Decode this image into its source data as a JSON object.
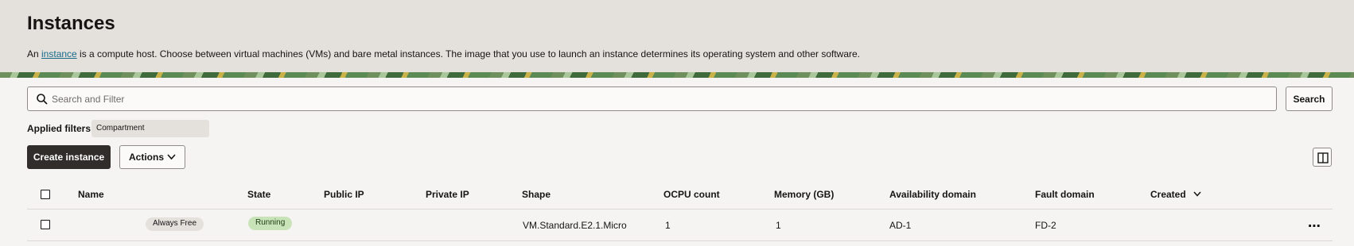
{
  "page": {
    "title": "Instances",
    "intro_prefix": "An ",
    "intro_link": "instance",
    "intro_suffix": " is a compute host. Choose between virtual machines (VMs) and bare metal instances. The image that you use to launch an instance determines its operating system and other software."
  },
  "search": {
    "placeholder": "Search and Filter",
    "button_label": "Search",
    "icon": "search-icon"
  },
  "filters": {
    "label": "Applied filters",
    "chips": [
      "Compartment"
    ]
  },
  "toolbar": {
    "create_label": "Create instance",
    "actions_label": "Actions",
    "columns_icon": "columns-icon"
  },
  "table": {
    "columns": {
      "name": "Name",
      "state": "State",
      "public_ip": "Public IP",
      "private_ip": "Private IP",
      "shape": "Shape",
      "ocpu": "OCPU count",
      "memory": "Memory (GB)",
      "ad": "Availability domain",
      "fd": "Fault domain",
      "created": "Created"
    },
    "rows": [
      {
        "name_badge": "Always Free",
        "state": "Running",
        "public_ip": "",
        "private_ip": "",
        "shape": "VM.Standard.E2.1.Micro",
        "ocpu": "1",
        "memory": "1",
        "ad": "AD-1",
        "fd": "FD-2",
        "more": "⋯"
      }
    ]
  },
  "colors": {
    "header_bg": "#e4e1dd",
    "primary_button": "#312d2a",
    "running_badge": "#c9e3b8",
    "link": "#1a6b8a"
  }
}
